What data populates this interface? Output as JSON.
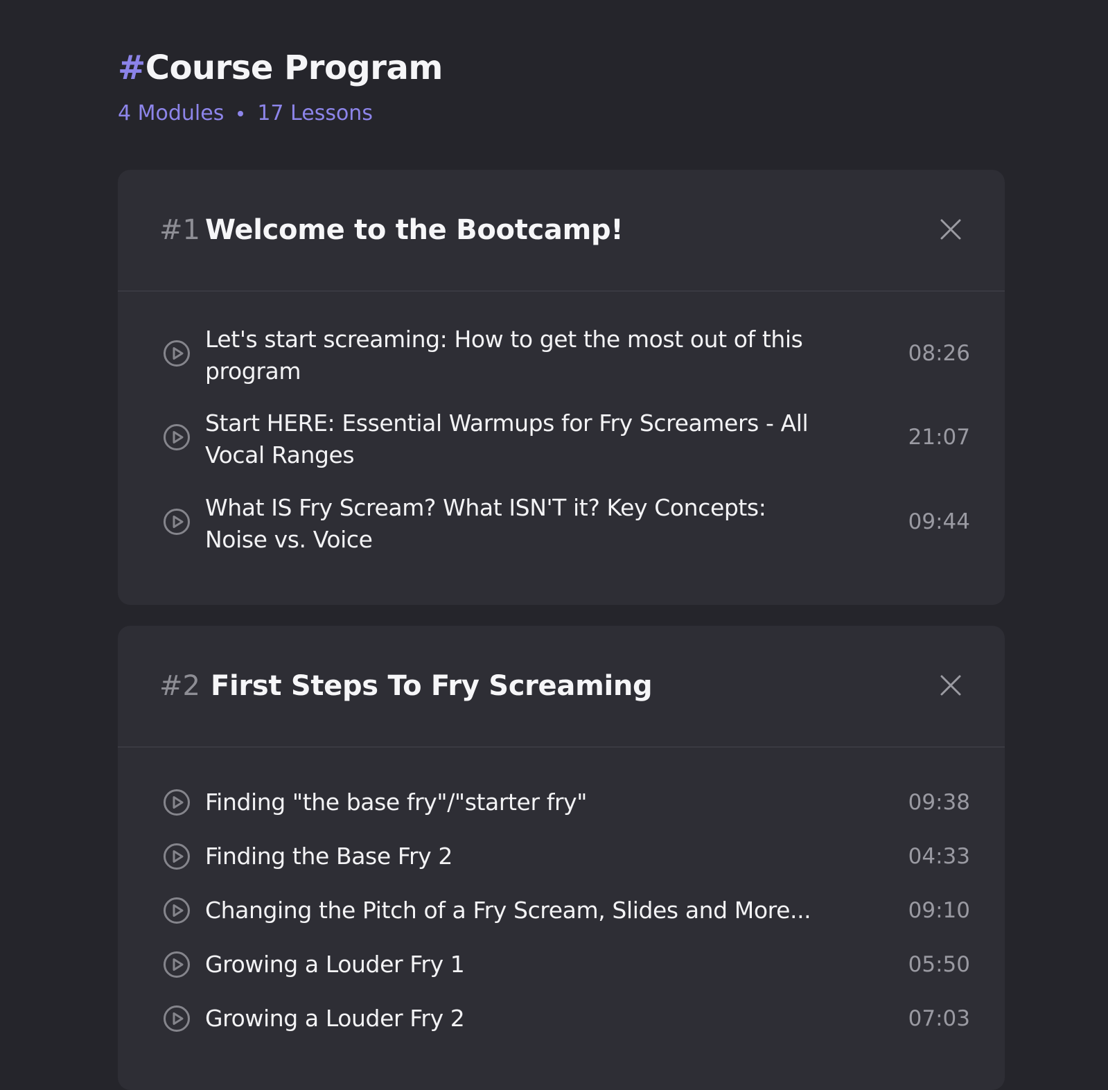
{
  "header": {
    "hash": "#",
    "title": "Course Program",
    "modules_count": "4 Modules",
    "lessons_count": "17 Lessons"
  },
  "modules": [
    {
      "number": "#1",
      "title": "Welcome to the Bootcamp!",
      "lessons": [
        {
          "title": "Let's start screaming: How to get the most out of this program",
          "duration": "08:26"
        },
        {
          "title": "Start HERE: Essential Warmups for Fry Screamers - All Vocal Ranges",
          "duration": "21:07"
        },
        {
          "title": "What IS Fry Scream? What ISN'T it? Key Concepts: Noise vs. Voice",
          "duration": "09:44"
        }
      ]
    },
    {
      "number": "#2",
      "title": "First Steps To Fry Screaming",
      "lessons": [
        {
          "title": "Finding \"the base fry\"/\"starter fry\"",
          "duration": "09:38"
        },
        {
          "title": "Finding the Base Fry 2",
          "duration": "04:33"
        },
        {
          "title": "Changing the Pitch of a Fry Scream, Slides and More...",
          "duration": "09:10"
        },
        {
          "title": "Growing a Louder Fry 1",
          "duration": "05:50"
        },
        {
          "title": "Growing a Louder Fry 2",
          "duration": "07:03"
        }
      ]
    }
  ],
  "icons": {
    "play": "play-circle-icon",
    "close": "close-icon"
  },
  "colors": {
    "background": "#25252b",
    "card": "#2e2e35",
    "accent": "#8b83e8",
    "muted": "#9a9aa2"
  }
}
